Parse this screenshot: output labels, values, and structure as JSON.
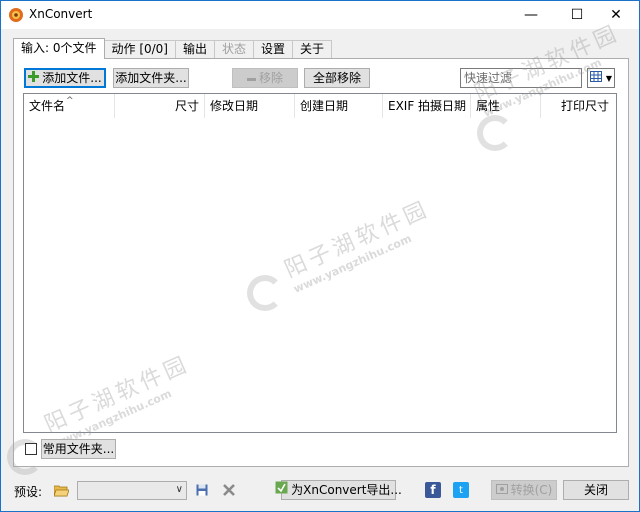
{
  "window": {
    "title": "XnConvert",
    "minimize": "—",
    "maximize": "☐",
    "close": "✕"
  },
  "tabs": [
    {
      "label": "输入: 0个文件",
      "active": true
    },
    {
      "label": "动作 [0/0]"
    },
    {
      "label": "输出"
    },
    {
      "label": "状态",
      "disabled": true
    },
    {
      "label": "设置"
    },
    {
      "label": "关于"
    }
  ],
  "toolbar": {
    "add_files": "添加文件...",
    "add_folder": "添加文件夹...",
    "remove": "移除",
    "remove_all": "全部移除",
    "filter_placeholder": "快速过滤"
  },
  "list": {
    "columns": [
      "文件名",
      "尺寸",
      "修改日期",
      "创建日期",
      "EXIF 拍摄日期",
      "属性",
      "打印尺寸"
    ]
  },
  "bottom": {
    "hot_folders": "常用文件夹...",
    "preset_label": "预设:",
    "preset_value": "",
    "export_button": "为XnConvert导出...",
    "convert_button": "转换(C)",
    "close_button": "关闭"
  },
  "watermark": {
    "cn": "阳子湖软件园",
    "en": "www.yangzhihu.com"
  },
  "colors": {
    "accent": "#0078d7",
    "facebook": "#3b5998",
    "twitter": "#1da1f2"
  }
}
